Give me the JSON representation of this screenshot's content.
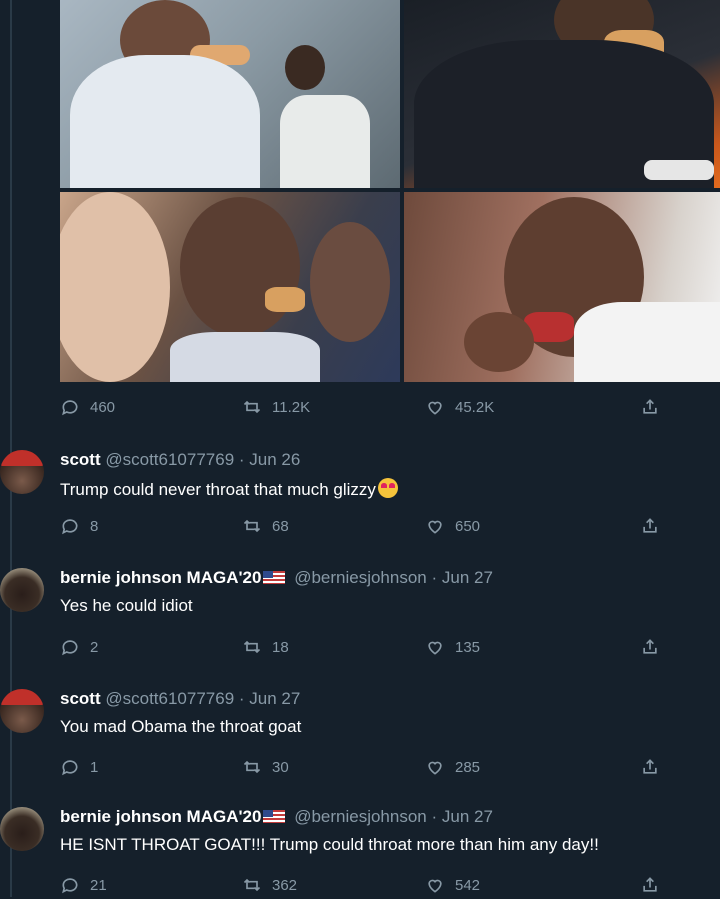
{
  "main_tweet": {
    "actions": {
      "replies": "460",
      "retweets": "11.2K",
      "likes": "45.2K"
    }
  },
  "replies": [
    {
      "name": "scott",
      "handle": "@scott61077769",
      "date": "· Jun 26",
      "text": "Trump could never throat that much glizzy",
      "emoji": "heart-eyes",
      "actions": {
        "replies": "8",
        "retweets": "68",
        "likes": "650"
      }
    },
    {
      "name": "bernie johnson MAGA'20",
      "handle": "@berniesjohnson",
      "date": "· Jun 27",
      "text": "Yes he could idiot",
      "actions": {
        "replies": "2",
        "retweets": "18",
        "likes": "135"
      }
    },
    {
      "name": "scott",
      "handle": "@scott61077769",
      "date": "· Jun 27",
      "text": "You mad Obama the throat goat",
      "actions": {
        "replies": "1",
        "retweets": "30",
        "likes": "285"
      }
    },
    {
      "name": "bernie johnson MAGA'20",
      "handle": "@berniesjohnson",
      "date": "· Jun 27",
      "text": "HE ISNT THROAT GOAT!!! Trump could throat more than him any day!!",
      "actions": {
        "replies": "21",
        "retweets": "362",
        "likes": "542"
      }
    }
  ],
  "colors": {
    "background": "#15202b",
    "muted": "#8899a6",
    "text": "#ffffff"
  }
}
